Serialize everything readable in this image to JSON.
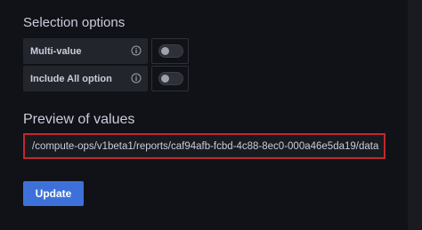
{
  "selection_options": {
    "title": "Selection options",
    "options": [
      {
        "label": "Multi-value",
        "enabled": false
      },
      {
        "label": "Include All option",
        "enabled": false
      }
    ]
  },
  "preview": {
    "title": "Preview of values",
    "value": "/compute-ops/v1beta1/reports/caf94afb-fcbd-4c88-8ec0-000a46e5da19/data"
  },
  "update_label": "Update",
  "icons": {
    "info": "info-circle-icon"
  },
  "colors": {
    "background": "#111217",
    "primary_button": "#3d71d9",
    "highlight_border": "#c1282d",
    "text": "#ccccdc"
  }
}
